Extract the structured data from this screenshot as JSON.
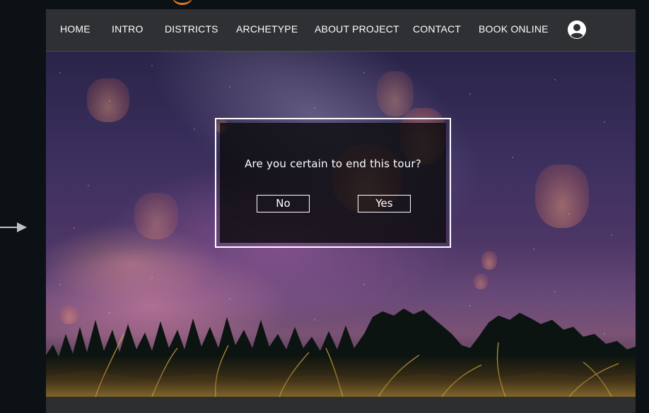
{
  "nav": {
    "items": [
      {
        "label": "HOME"
      },
      {
        "label": "INTRO"
      },
      {
        "label": "DISTRICTS"
      },
      {
        "label": "ARCHETYPE"
      },
      {
        "label": "ABOUT PROJECT"
      },
      {
        "label": "CONTACT"
      },
      {
        "label": "BOOK ONLINE"
      }
    ],
    "account_icon": "user-circle-icon"
  },
  "dialog": {
    "message": "Are you certain to end this tour?",
    "no_label": "No",
    "yes_label": "Yes"
  },
  "side_icon": "right-arrow-icon",
  "colors": {
    "page_background": "#0c1116",
    "navbar_background": "#2e3033",
    "nav_text": "#ffffff",
    "accent_orange": "#e07a1f",
    "dialog_border": "#ffffff",
    "dialog_background": "#0c0c0e"
  }
}
